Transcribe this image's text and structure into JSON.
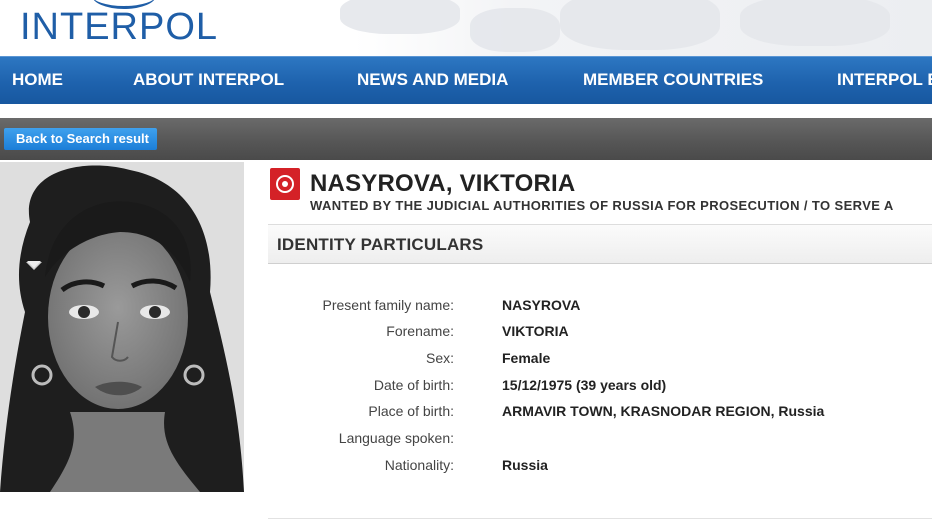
{
  "header": {
    "logo_text": "INTERPOL"
  },
  "nav": {
    "items": [
      {
        "label": "HOME"
      },
      {
        "label": "ABOUT INTERPOL"
      },
      {
        "label": "NEWS AND MEDIA"
      },
      {
        "label": "MEMBER COUNTRIES"
      },
      {
        "label": "INTERPOL E"
      }
    ]
  },
  "toolbar": {
    "back_label": "Back to Search result"
  },
  "notice": {
    "name": "NASYROVA, VIKTORIA",
    "wanted": "WANTED BY THE JUDICIAL AUTHORITIES OF RUSSIA FOR PROSECUTION / TO SERVE A"
  },
  "section": {
    "title": "IDENTITY PARTICULARS"
  },
  "particulars": [
    {
      "label": "Present family name:",
      "value": "NASYROVA"
    },
    {
      "label": "Forename:",
      "value": "VIKTORIA"
    },
    {
      "label": "Sex:",
      "value": "Female"
    },
    {
      "label": "Date of birth:",
      "value": "15/12/1975 (39 years old)"
    },
    {
      "label": "Place of birth:",
      "value": "ARMAVIR TOWN, KRASNODAR REGION, Russia"
    },
    {
      "label": "Language spoken:",
      "value": ""
    },
    {
      "label": "Nationality:",
      "value": "Russia"
    }
  ],
  "colors": {
    "brand_blue": "#1f5ea7",
    "nav_blue": "#1e62ad",
    "button_blue": "#1c7ed8",
    "notice_red": "#d42127",
    "toolbar_grey": "#555555"
  },
  "icons": {
    "notice_icon": "red-notice-icon",
    "photo": "person-photo"
  }
}
